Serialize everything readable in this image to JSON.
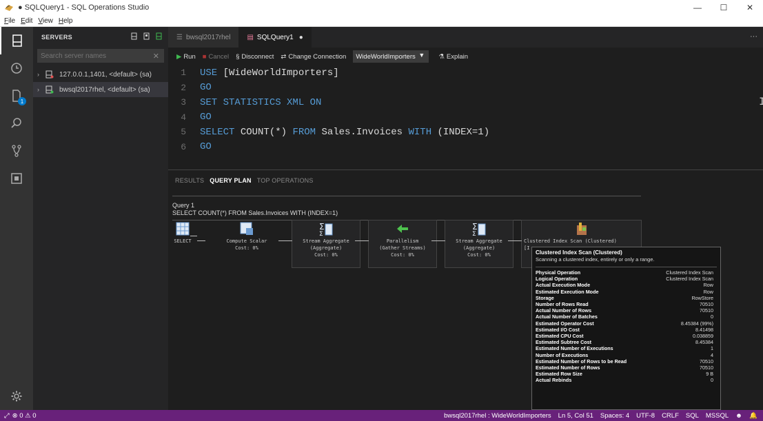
{
  "window": {
    "title": "● SQLQuery1 - SQL Operations Studio",
    "minimize": "—",
    "maximize": "☐",
    "close": "✕"
  },
  "menu": [
    "File",
    "Edit",
    "View",
    "Help"
  ],
  "activity": {
    "explorer_badge": "1"
  },
  "sidebar": {
    "header": "SERVERS",
    "search_placeholder": "Search server names",
    "servers": [
      {
        "label": "127.0.0.1,1401, <default> (sa)"
      },
      {
        "label": "bwsql2017rhel, <default> (sa)"
      }
    ]
  },
  "tabs": [
    {
      "label": "bwsql2017rhel"
    },
    {
      "label": "SQLQuery1",
      "dirty": "●"
    }
  ],
  "tabs_more": "···",
  "toolbar": {
    "run": "Run",
    "cancel": "Cancel",
    "disconnect": "Disconnect",
    "change_connection": "Change Connection",
    "database": "WideWorldImporters",
    "explain": "Explain"
  },
  "code": [
    {
      "n": "1",
      "parts": [
        [
          "kw",
          "USE "
        ],
        [
          "id",
          "[WideWorldImporters]"
        ]
      ]
    },
    {
      "n": "2",
      "parts": [
        [
          "kw",
          "GO"
        ]
      ]
    },
    {
      "n": "3",
      "parts": [
        [
          "kw",
          "SET STATISTICS XML ON"
        ]
      ]
    },
    {
      "n": "4",
      "parts": [
        [
          "kw",
          "GO"
        ]
      ]
    },
    {
      "n": "5",
      "parts": [
        [
          "kw",
          "SELECT "
        ],
        [
          "id",
          "COUNT(*) "
        ],
        [
          "kw",
          "FROM "
        ],
        [
          "id",
          "Sales.Invoices "
        ],
        [
          "kw",
          "WITH "
        ],
        [
          "id",
          "(INDEX=1)"
        ]
      ]
    },
    {
      "n": "6",
      "parts": [
        [
          "kw",
          "GO"
        ]
      ]
    }
  ],
  "results": {
    "tabs": [
      "RESULTS",
      "QUERY PLAN",
      "TOP OPERATIONS"
    ],
    "query_label": "Query 1",
    "query_text": "SELECT COUNT(*) FROM Sales.Invoices WITH (INDEX=1)"
  },
  "plan": [
    {
      "name": "SELECT",
      "lines": [
        "SELECT"
      ]
    },
    {
      "name": "Compute Scalar",
      "lines": [
        "Compute Scalar",
        "Cost: 0%"
      ]
    },
    {
      "name": "Stream Aggregate",
      "lines": [
        "Stream Aggregate",
        "(Aggregate)",
        "Cost: 0%"
      ]
    },
    {
      "name": "Parallelism",
      "lines": [
        "Parallelism",
        "(Gather Streams)",
        "Cost: 0%"
      ]
    },
    {
      "name": "Stream Aggregate",
      "lines": [
        "Stream Aggregate",
        "(Aggregate)",
        "Cost: 0%"
      ]
    },
    {
      "name": "Clustered Index Scan",
      "lines": [
        "Clustered Index Scan (Clustered)",
        "[I"
      ]
    }
  ],
  "tooltip": {
    "title": "Clustered Index Scan (Clustered)",
    "description": "Scanning a clustered index, entirely or only a range.",
    "rows": [
      [
        "Physical Operation",
        "Clustered Index Scan"
      ],
      [
        "Logical Operation",
        "Clustered Index Scan"
      ],
      [
        "Actual Execution Mode",
        "Row"
      ],
      [
        "Estimated Execution Mode",
        "Row"
      ],
      [
        "Storage",
        "RowStore"
      ],
      [
        "Number of Rows Read",
        "70510"
      ],
      [
        "Actual Number of Rows",
        "70510"
      ],
      [
        "Actual Number of Batches",
        "0"
      ],
      [
        "Estimated Operator Cost",
        "8.45384 (99%)"
      ],
      [
        "Estimated I/O Cost",
        "8.41498"
      ],
      [
        "Estimated CPU Cost",
        "0.038859"
      ],
      [
        "Estimated Subtree Cost",
        "8.45384"
      ],
      [
        "Estimated Number of Executions",
        "1"
      ],
      [
        "Number of Executions",
        "4"
      ],
      [
        "Estimated Number of Rows to be Read",
        "70510"
      ],
      [
        "Estimated Number of Rows",
        "70510"
      ],
      [
        "Estimated Row Size",
        "9 B"
      ],
      [
        "Actual Rebinds",
        "0"
      ]
    ]
  },
  "status": {
    "left": "⊗ 0  ⚠ 0",
    "connection": "bwsql2017rhel : WideWorldImporters",
    "position": "Ln 5, Col 51",
    "spaces": "Spaces: 4",
    "encoding": "UTF-8",
    "eol": "CRLF",
    "language": "SQL",
    "provider": "MSSQL"
  },
  "colors": {
    "status_bar": "#68217a",
    "keyword": "#569cd6",
    "accent": "#007acc"
  }
}
